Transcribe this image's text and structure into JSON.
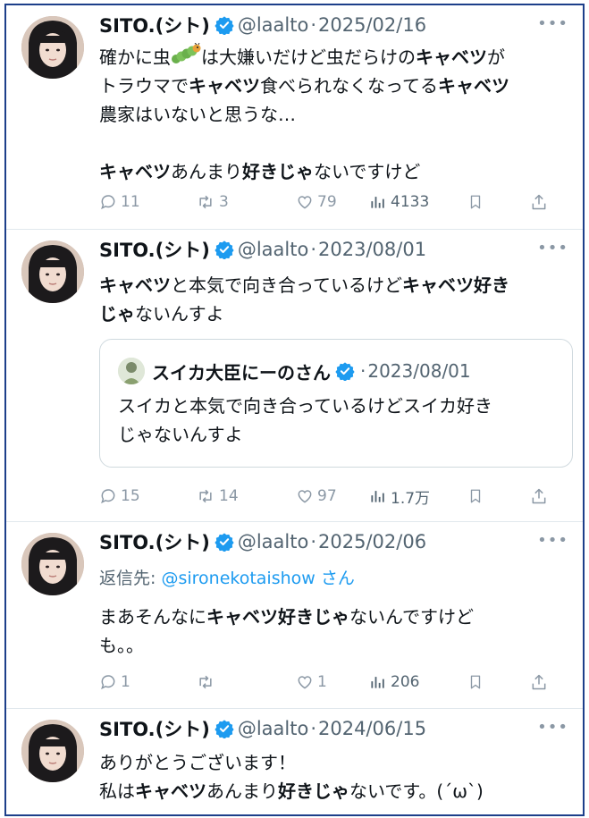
{
  "accent_color": "#1d9bf0",
  "tweets": [
    {
      "name": "SITO.(シト)",
      "handle": "@laalto",
      "sep": "·",
      "date": "2025/02/16",
      "more": "•••",
      "lines": [
        [
          {
            "t": "確かに虫",
            "b": false
          },
          {
            "emoji": "caterpillar"
          },
          {
            "t": "は大嫌いだけど虫だらけの",
            "b": false
          },
          {
            "t": "キャベツ",
            "b": true
          },
          {
            "t": "が",
            "b": false
          }
        ],
        [
          {
            "t": "トラウマで",
            "b": false
          },
          {
            "t": "キャベツ",
            "b": true
          },
          {
            "t": "食べられなくなってる",
            "b": false
          },
          {
            "t": "キャベツ",
            "b": true
          }
        ],
        [
          {
            "t": "農家はいないと思うな…",
            "b": false
          }
        ],
        [],
        [
          {
            "t": "キャベツ",
            "b": true
          },
          {
            "t": "あんまり",
            "b": false
          },
          {
            "t": "好きじゃ",
            "b": true
          },
          {
            "t": "ないですけど",
            "b": false
          }
        ]
      ],
      "stats": {
        "replies": "11",
        "reposts": "3",
        "likes": "79",
        "views": "4133"
      }
    },
    {
      "name": "SITO.(シト)",
      "handle": "@laalto",
      "sep": "·",
      "date": "2023/08/01",
      "more": "•••",
      "lines": [
        [
          {
            "t": "キャベツ",
            "b": true
          },
          {
            "t": "と本気で向き合っているけど",
            "b": false
          },
          {
            "t": "キャベツ好き",
            "b": true
          }
        ],
        [
          {
            "t": "じゃ",
            "b": true
          },
          {
            "t": "ないんすよ",
            "b": false
          }
        ]
      ],
      "quote": {
        "name": "スイカ大臣にーのさん",
        "sep": "·",
        "date": "2023/08/01",
        "lines": [
          "スイカと本気で向き合っているけどスイカ好き",
          "じゃないんすよ"
        ]
      },
      "stats": {
        "replies": "15",
        "reposts": "14",
        "likes": "97",
        "views": "1.7万"
      }
    },
    {
      "name": "SITO.(シト)",
      "handle": "@laalto",
      "sep": "·",
      "date": "2025/02/06",
      "more": "•••",
      "reply_prefix": "返信先: ",
      "reply_to": "@sironekotaishow",
      "reply_suffix": " さん",
      "lines": [
        [
          {
            "t": "まあそんなに",
            "b": false
          },
          {
            "t": "キャベツ好きじゃ",
            "b": true
          },
          {
            "t": "ないんですけど",
            "b": false
          }
        ],
        [
          {
            "t": "も。。",
            "b": false
          }
        ]
      ],
      "stats": {
        "replies": "1",
        "reposts": "",
        "likes": "1",
        "views": "206"
      }
    },
    {
      "name": "SITO.(シト)",
      "handle": "@laalto",
      "sep": "·",
      "date": "2024/06/15",
      "more": "•••",
      "lines": [
        [
          {
            "t": "ありがとうございます！",
            "b": false
          }
        ],
        [
          {
            "t": "私は",
            "b": false
          },
          {
            "t": "キャベツ",
            "b": true
          },
          {
            "t": "あんまり",
            "b": false
          },
          {
            "t": "好きじゃ",
            "b": true
          },
          {
            "t": "ないです。(´ω`)",
            "b": false
          }
        ]
      ]
    }
  ]
}
